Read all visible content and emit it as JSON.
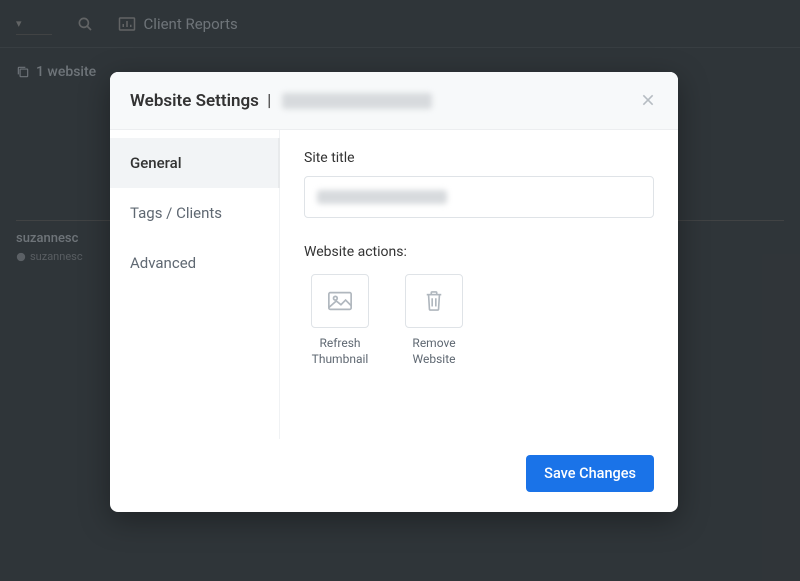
{
  "topbar": {
    "client_reports_label": "Client Reports"
  },
  "background": {
    "website_count_label": "1 website",
    "item_title": "suzannesc",
    "item_sub": "suzannesc"
  },
  "modal": {
    "title_prefix": "Website Settings",
    "title_separator": "|",
    "tabs": {
      "general": "General",
      "tags_clients": "Tags / Clients",
      "advanced": "Advanced"
    },
    "field": {
      "site_title_label": "Site title"
    },
    "actions": {
      "section_label": "Website actions:",
      "refresh_thumbnail": "Refresh Thumbnail",
      "remove_website": "Remove Website"
    },
    "footer": {
      "save_label": "Save Changes"
    }
  }
}
